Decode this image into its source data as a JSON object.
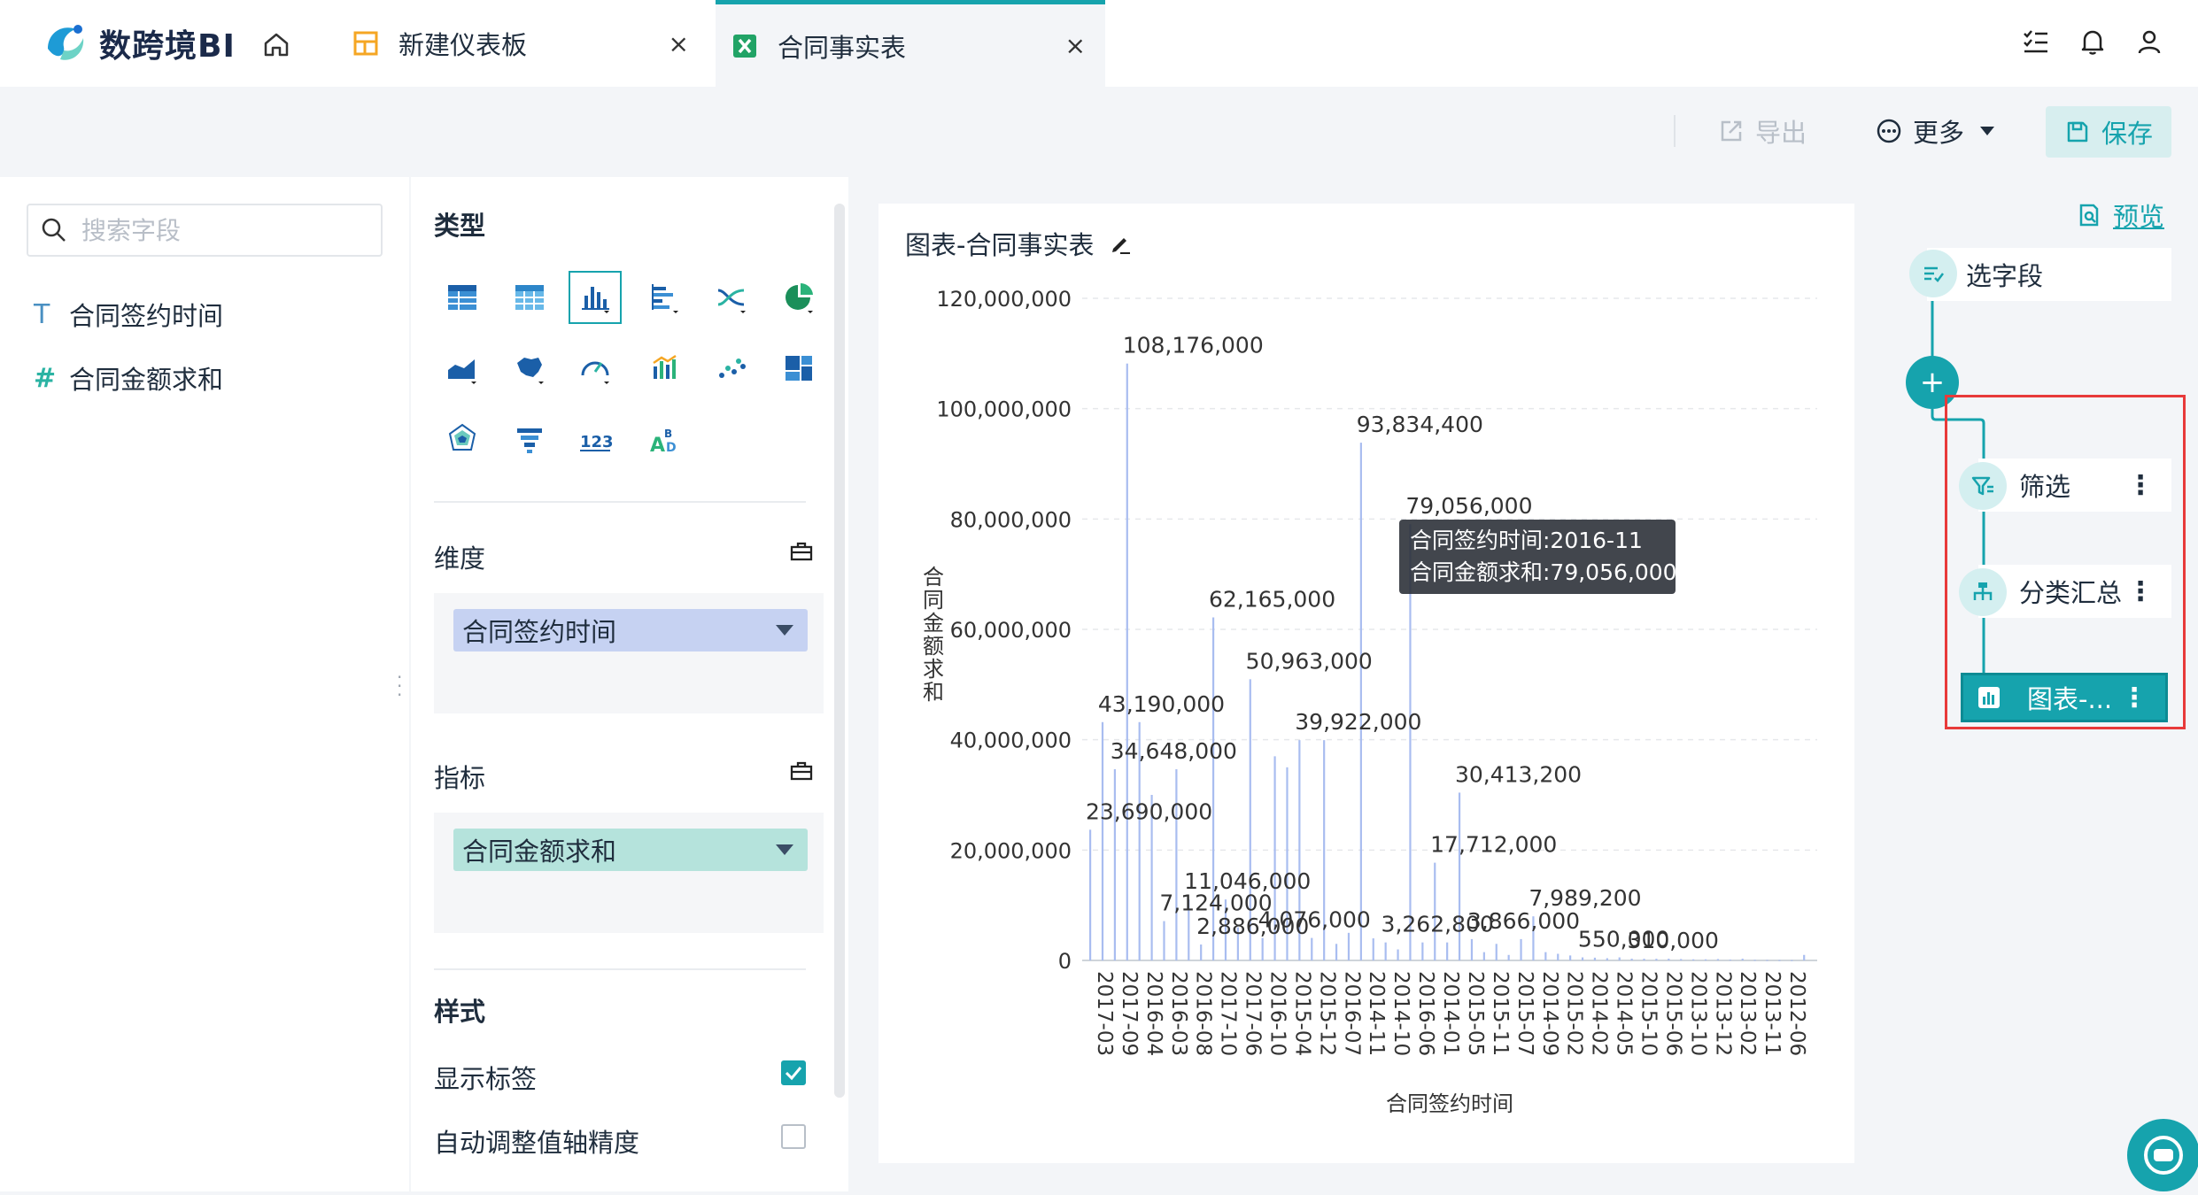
{
  "app": {
    "brand": "数跨境BI"
  },
  "tabs": [
    {
      "label": "新建仪表板",
      "close": "×"
    },
    {
      "label": "合同事实表",
      "close": "×"
    }
  ],
  "toolbar": {
    "export_label": "导出",
    "more_label": "更多",
    "save_label": "保存"
  },
  "fields": {
    "search_placeholder": "搜索字段",
    "items": [
      {
        "type_symbol": "T",
        "name": "合同签约时间"
      },
      {
        "type_symbol": "#",
        "name": "合同金额求和"
      }
    ]
  },
  "config": {
    "type_title": "类型",
    "dimension_label": "维度",
    "dimension_chip": "合同签约时间",
    "metric_label": "指标",
    "metric_chip": "合同金额求和",
    "style_title": "样式",
    "options": [
      {
        "label": "显示标签",
        "checked": true
      },
      {
        "label": "自动调整值轴精度",
        "checked": false
      }
    ]
  },
  "chart": {
    "title": "图表-合同事实表",
    "tooltip": {
      "line1": "合同签约时间:2016-11",
      "line2": "合同金额求和:79,056,000"
    }
  },
  "chart_data": {
    "type": "bar",
    "title": "图表-合同事实表",
    "xlabel": "合同签约时间",
    "ylabel": "合同金额求和",
    "ylim": [
      0,
      120000000
    ],
    "yticks": [
      "0",
      "20,000,000",
      "40,000,000",
      "60,000,000",
      "80,000,000",
      "100,000,000",
      "120,000,000"
    ],
    "xtick_labels": [
      "2017-03",
      "2017-09",
      "2016-04",
      "2016-03",
      "2016-08",
      "2017-10",
      "2017-06",
      "2016-10",
      "2015-04",
      "2015-12",
      "2016-07",
      "2014-11",
      "2014-10",
      "2016-06",
      "2014-01",
      "2015-05",
      "2015-11",
      "2015-07",
      "2014-09",
      "2015-02",
      "2014-02",
      "2014-05",
      "2015-10",
      "2015-06",
      "2013-10",
      "2013-12",
      "2013-02",
      "2013-11",
      "2012-06"
    ],
    "bars": [
      23690000,
      43190000,
      34648000,
      108176000,
      43190000,
      30000000,
      7124000,
      34648000,
      11046000,
      2886000,
      62165000,
      11046000,
      6000000,
      50963000,
      4076000,
      37000000,
      35000000,
      39922000,
      4076000,
      39922000,
      3000000,
      5000000,
      93834400,
      4000000,
      3262800,
      2000000,
      79056000,
      3262800,
      17712000,
      3262800,
      30413200,
      3866000,
      1500000,
      3000000,
      1000000,
      3866000,
      7989200,
      1500000,
      1200000,
      900000,
      550000,
      500000,
      400000,
      550000,
      310000,
      300000,
      300000,
      310000,
      250000,
      200000,
      200000,
      250000,
      150000,
      310000,
      100000,
      80000,
      60000,
      50000,
      1000000
    ],
    "data_labels": [
      {
        "bar_index": 3,
        "text": "108,176,000"
      },
      {
        "bar_index": 22,
        "text": "93,834,400"
      },
      {
        "bar_index": 26,
        "text": "79,056,000"
      },
      {
        "bar_index": 10,
        "text": "62,165,000"
      },
      {
        "bar_index": 13,
        "text": "50,963,000"
      },
      {
        "bar_index": 1,
        "text": "43,190,000"
      },
      {
        "bar_index": 17,
        "text": "39,922,000"
      },
      {
        "bar_index": 2,
        "text": "34,648,000"
      },
      {
        "bar_index": 30,
        "text": "30,413,200"
      },
      {
        "bar_index": 0,
        "text": "23,690,000"
      },
      {
        "bar_index": 28,
        "text": "17,712,000"
      },
      {
        "bar_index": 8,
        "text": "11,046,000"
      },
      {
        "bar_index": 6,
        "text": "7,124,000"
      },
      {
        "bar_index": 36,
        "text": "7,989,200"
      },
      {
        "bar_index": 14,
        "text": "4,076,000"
      },
      {
        "bar_index": 9,
        "text": "2,886,000"
      },
      {
        "bar_index": 24,
        "text": "3,262,800"
      },
      {
        "bar_index": 31,
        "text": "3,866,000"
      },
      {
        "bar_index": 40,
        "text": "550,000"
      },
      {
        "bar_index": 44,
        "text": "310,000"
      }
    ],
    "grid": true,
    "bar_color": "#a9bdf0"
  },
  "flow": {
    "preview_label": "预览",
    "select_fields": "选字段",
    "filter": "筛选",
    "group_summary": "分类汇总",
    "chart_node": "图表-...",
    "add_symbol": "+"
  },
  "colors": {
    "accent": "#16a3ad",
    "highlight_border": "#e83a3a"
  }
}
